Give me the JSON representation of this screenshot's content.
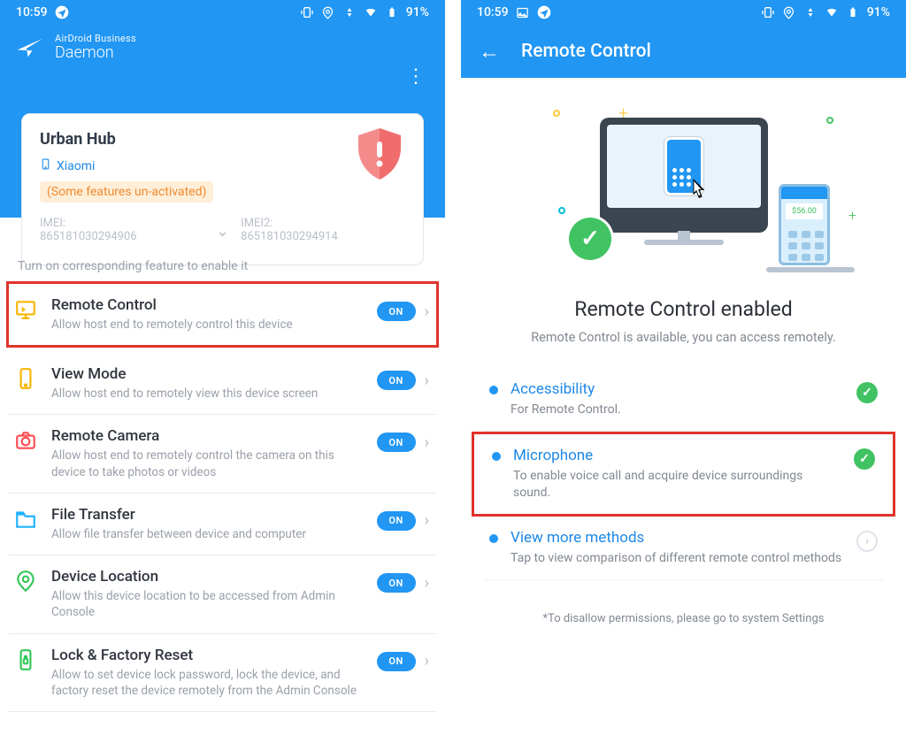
{
  "status": {
    "time": "10:59",
    "battery": "91%"
  },
  "left": {
    "app_top": "AirDroid Business",
    "app_bottom": "Daemon",
    "device_name": "Urban Hub",
    "brand": "Xiaomi",
    "warn": "(Some features un-activated)",
    "imei1_label": "IMEI:",
    "imei1_value": "865181030294906",
    "imei2_label": "IMEI2:",
    "imei2_value": "865181030294914",
    "hint": "Turn on corresponding feature to enable it",
    "features": [
      {
        "title": "Remote Control",
        "desc": "Allow host end to remotely control this device",
        "toggle": "ON",
        "color": "#f7b500",
        "highlight": true
      },
      {
        "title": "View Mode",
        "desc": "Allow host end to remotely view this device screen",
        "toggle": "ON",
        "color": "#f7b500"
      },
      {
        "title": "Remote Camera",
        "desc": "Allow host end to remotely control the camera on this device to take photos or videos",
        "toggle": "ON",
        "color": "#ff4d52"
      },
      {
        "title": "File Transfer",
        "desc": "Allow file transfer between device and computer",
        "toggle": "ON",
        "color": "#1fb3ff"
      },
      {
        "title": "Device Location",
        "desc": "Allow this device location to be accessed from Admin Console",
        "toggle": "ON",
        "color": "#34c759"
      },
      {
        "title": "Lock & Factory Reset",
        "desc": "Allow to set device lock password, lock the device, and factory reset the device remotely from the Admin Console",
        "toggle": "ON",
        "color": "#34c759"
      }
    ]
  },
  "right": {
    "header": "Remote Control",
    "heading": "Remote Control enabled",
    "sub": "Remote Control is available, you can access remotely.",
    "perms": [
      {
        "title": "Accessibility",
        "desc": "For Remote Control.",
        "state": "check"
      },
      {
        "title": "Microphone",
        "desc": "To enable voice call and acquire device surroundings sound.",
        "state": "check",
        "highlight": true
      },
      {
        "title": "View more methods",
        "desc": "Tap to view comparison of different remote control methods",
        "state": "more"
      }
    ],
    "footnote": "*To disallow permissions, please go to system Settings"
  }
}
